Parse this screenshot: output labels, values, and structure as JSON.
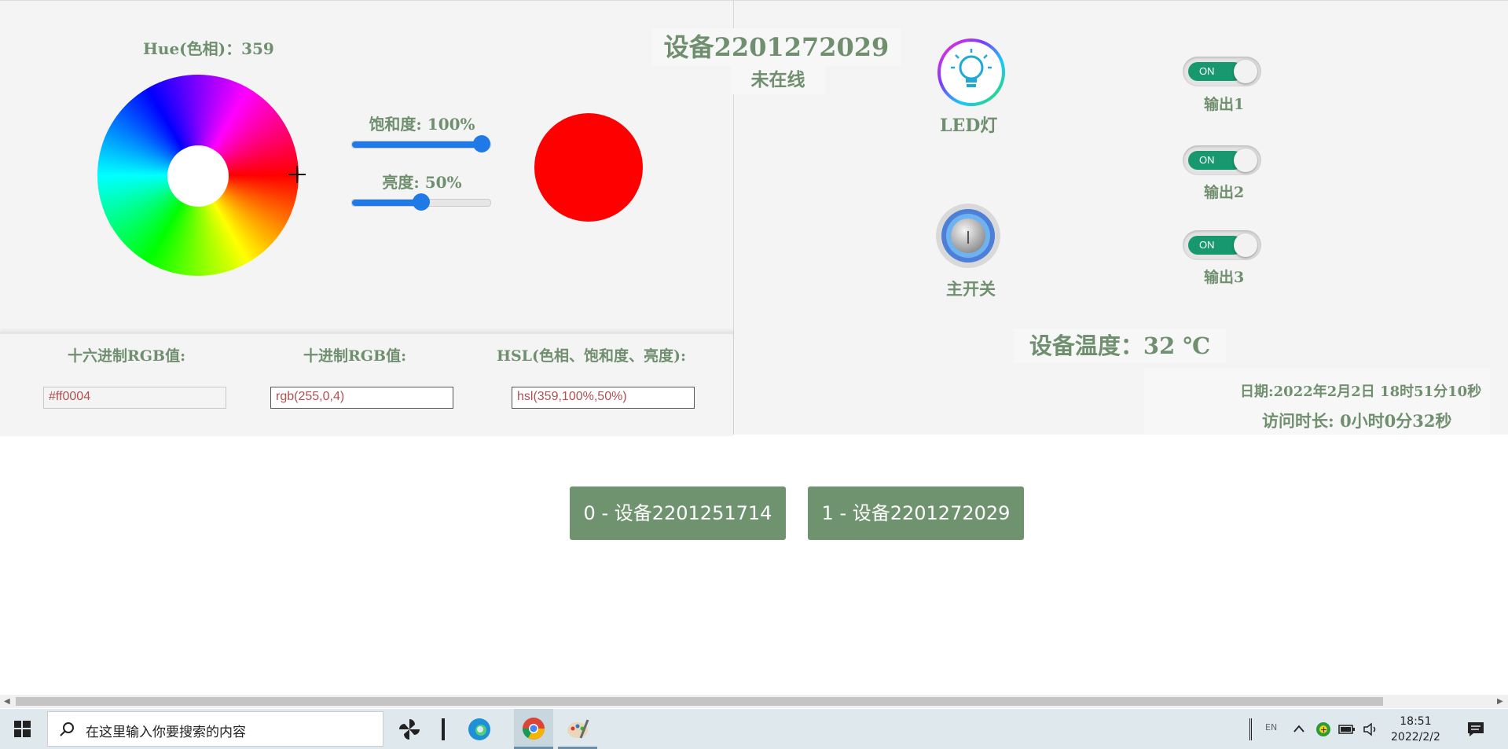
{
  "color_picker": {
    "hue_label": "Hue(色相)：",
    "hue_value": "359",
    "saturation_label": "饱和度: 100%",
    "saturation_percent": 100,
    "lightness_label": "亮度: 50%",
    "lightness_percent": 50,
    "swatch_color": "#ff0000",
    "fields": {
      "hex_label": "十六进制RGB值:",
      "hex_value": "#ff0004",
      "rgb_label": "十进制RGB值:",
      "rgb_value": "rgb(255,0,4)",
      "hsl_label": "HSL(色相、饱和度、亮度):",
      "hsl_value": "hsl(359,100%,50%)"
    }
  },
  "device": {
    "title": "设备2201272029",
    "status": "未在线",
    "led_label": "LED灯",
    "main_switch_label": "主开关",
    "outputs": [
      {
        "label": "输出1",
        "state": "ON"
      },
      {
        "label": "输出2",
        "state": "ON"
      },
      {
        "label": "输出3",
        "state": "ON"
      }
    ],
    "temperature": "设备温度：32 ℃",
    "date": "日期:2022年2月2日 18时51分10秒",
    "visit_duration": "访问时长: 0小时0分32秒"
  },
  "device_buttons": [
    {
      "label": "0 - 设备2201251714"
    },
    {
      "label": "1 - 设备2201272029"
    }
  ],
  "colors": {
    "accent_green": "#6f936f",
    "toggle_green": "#18986f",
    "slider_blue": "#1f7ae8"
  },
  "taskbar": {
    "search_placeholder": "在这里输入你要搜索的内容",
    "lang": "EN",
    "time": "18:51",
    "date": "2022/2/2",
    "icons": [
      "windows-start-icon",
      "search-icon",
      "pinwheel-app-icon",
      "edge-icon",
      "chrome-icon",
      "paint-icon",
      "chevron-up-icon",
      "shield-icon",
      "battery-icon",
      "volume-icon",
      "notification-icon"
    ]
  }
}
